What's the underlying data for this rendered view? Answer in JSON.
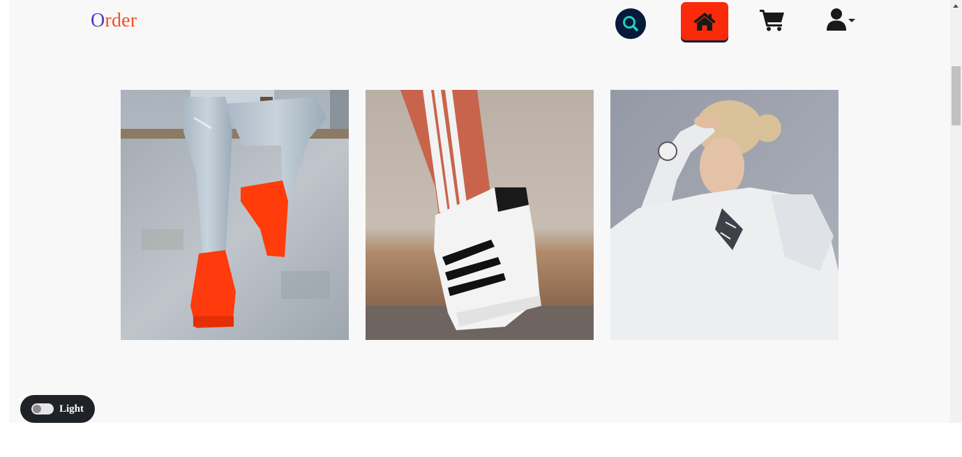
{
  "header": {
    "logo_first_letter": "O",
    "logo_rest": "rder"
  },
  "nav": {
    "search_icon": "search-icon",
    "home_icon": "home-icon",
    "cart_icon": "cart-icon",
    "user_icon": "user-icon"
  },
  "gallery": {
    "tiles": [
      {
        "subject": "orange-sneakers-jeans"
      },
      {
        "subject": "adidas-superstar-sneaker"
      },
      {
        "subject": "woman-adidas-hoodie"
      }
    ]
  },
  "theme_toggle": {
    "label": "Light"
  },
  "colors": {
    "logo_first": "#4b3fc4",
    "logo_rest": "#f0521f",
    "home_active": "#fa2a0a",
    "search_bg": "#081a3a",
    "search_icon": "#1fd1c1",
    "toggle_bg": "#1f2226"
  }
}
